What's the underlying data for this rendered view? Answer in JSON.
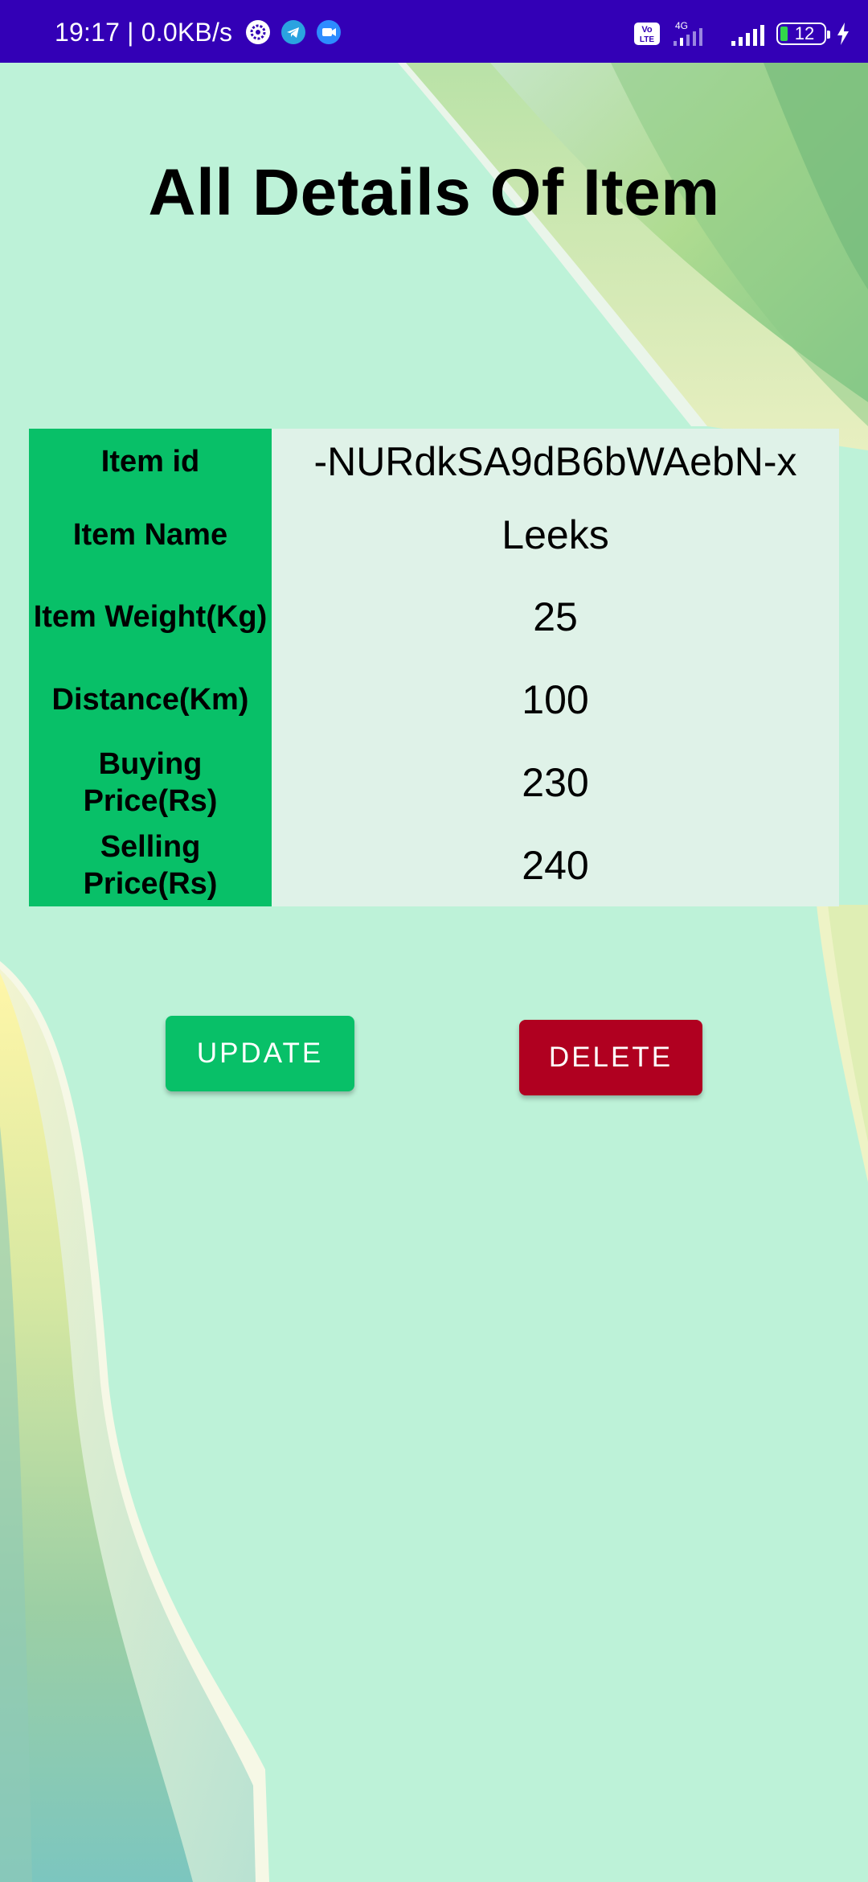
{
  "status_bar": {
    "time_speed": "19:17 | 0.0KB/s",
    "network_label": "4G",
    "volte_label": "Vo LTE",
    "battery_level": "12",
    "notification_icons": [
      "gear-icon",
      "telegram-icon",
      "video-call-icon"
    ],
    "status_icons": [
      "volte-icon",
      "signal-4g-icon",
      "signal-icon",
      "battery-icon",
      "charging-bolt-icon"
    ]
  },
  "page": {
    "title": "All Details Of Item"
  },
  "details": [
    {
      "label": "Item id",
      "value": "-NURdkSA9dB6bWAebN-x"
    },
    {
      "label": "Item Name",
      "value": "Leeks"
    },
    {
      "label": "Item Weight(Kg)",
      "value": "25"
    },
    {
      "label": "Distance(Km)",
      "value": "100"
    },
    {
      "label": "Buying Price(Rs)",
      "value": "230"
    },
    {
      "label": "Selling Price(Rs)",
      "value": "240"
    }
  ],
  "actions": {
    "update_label": "UPDATE",
    "delete_label": "DELETE"
  },
  "colors": {
    "status_bar": "#3300b6",
    "background": "#bdf2d8",
    "label_cell": "#08c068",
    "value_cell": "#dff2e8",
    "update_button": "#08c068",
    "delete_button": "#b00020"
  }
}
